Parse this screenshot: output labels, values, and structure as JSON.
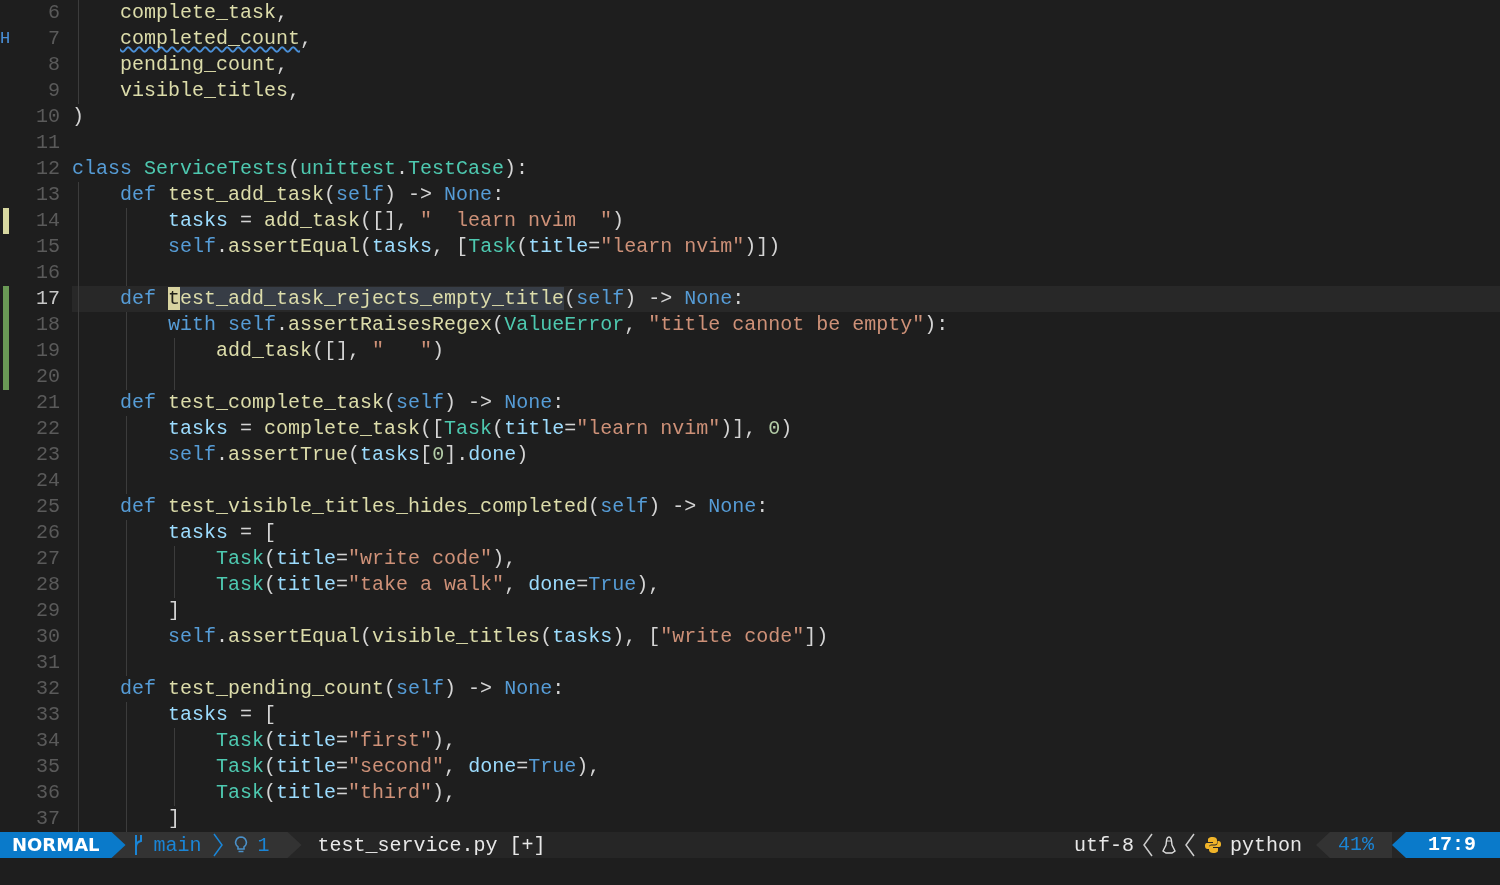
{
  "editor": {
    "lines": [
      {
        "number": "6",
        "modified": false,
        "added": false,
        "current": false,
        "tokens": [
          {
            "text": "    complete_task",
            "kind": "function"
          },
          {
            "text": ",",
            "kind": "plain"
          }
        ]
      },
      {
        "number": "7",
        "sign": "H",
        "modified": false,
        "added": false,
        "current": false,
        "tokens": [
          {
            "text": "    completed_count",
            "kind": "function",
            "diagnostic": true
          },
          {
            "text": ",",
            "kind": "plain",
            "diagnostic": false
          }
        ]
      },
      {
        "number": "8",
        "modified": false,
        "added": false,
        "current": false,
        "tokens": [
          {
            "text": "    pending_count",
            "kind": "function"
          },
          {
            "text": ",",
            "kind": "plain"
          }
        ]
      },
      {
        "number": "9",
        "modified": false,
        "added": false,
        "current": false,
        "tokens": [
          {
            "text": "    visible_titles",
            "kind": "function"
          },
          {
            "text": ",",
            "kind": "plain"
          }
        ]
      },
      {
        "number": "10",
        "modified": false,
        "added": false,
        "current": false,
        "tokens": [
          {
            "text": ")",
            "kind": "plain"
          }
        ]
      },
      {
        "number": "11",
        "modified": false,
        "added": false,
        "current": false
      },
      {
        "number": "12",
        "modified": false,
        "added": false,
        "current": false,
        "tokens": [
          {
            "text": "class ",
            "kind": "keyword"
          },
          {
            "text": "ServiceTests",
            "kind": "type"
          },
          {
            "text": "(",
            "kind": "plain"
          },
          {
            "text": "unittest",
            "kind": "type"
          },
          {
            "text": ".",
            "kind": "plain"
          },
          {
            "text": "TestCase",
            "kind": "type"
          },
          {
            "text": "):",
            "kind": "plain"
          }
        ]
      },
      {
        "number": "13",
        "modified": false,
        "added": false,
        "current": false,
        "tokens": [
          {
            "text": "    def ",
            "kind": "keyword"
          },
          {
            "text": "test_add_task",
            "kind": "function"
          },
          {
            "text": "(",
            "kind": "plain"
          },
          {
            "text": "self",
            "kind": "keyword"
          },
          {
            "text": ") -> ",
            "kind": "plain"
          },
          {
            "text": "None",
            "kind": "keyword"
          },
          {
            "text": ":",
            "kind": "plain"
          }
        ]
      },
      {
        "number": "14",
        "modified": true,
        "added": false,
        "current": false,
        "tokens": [
          {
            "text": "        tasks",
            "kind": "variable"
          },
          {
            "text": " = ",
            "kind": "plain"
          },
          {
            "text": "add_task",
            "kind": "function"
          },
          {
            "text": "([], ",
            "kind": "plain"
          },
          {
            "text": "\"  learn nvim  \"",
            "kind": "string"
          },
          {
            "text": ")",
            "kind": "plain"
          }
        ]
      },
      {
        "number": "15",
        "modified": false,
        "added": false,
        "current": false,
        "tokens": [
          {
            "text": "        self",
            "kind": "keyword"
          },
          {
            "text": ".",
            "kind": "plain"
          },
          {
            "text": "assertEqual",
            "kind": "function"
          },
          {
            "text": "(",
            "kind": "plain"
          },
          {
            "text": "tasks",
            "kind": "variable"
          },
          {
            "text": ", [",
            "kind": "plain"
          },
          {
            "text": "Task",
            "kind": "type"
          },
          {
            "text": "(",
            "kind": "plain"
          },
          {
            "text": "title",
            "kind": "variable"
          },
          {
            "text": "=",
            "kind": "plain"
          },
          {
            "text": "\"learn nvim\"",
            "kind": "string"
          },
          {
            "text": ")])",
            "kind": "plain"
          }
        ]
      },
      {
        "number": "16",
        "modified": false,
        "added": false,
        "current": false
      },
      {
        "number": "17",
        "modified": false,
        "added": true,
        "current": true,
        "tokens": [
          {
            "text": "    def ",
            "kind": "keyword",
            "cursor": false,
            "highlighted": false
          },
          {
            "text": "t",
            "kind": "function",
            "cursor": true,
            "highlighted": true
          },
          {
            "text": "est_add_task_rejects_empty_title",
            "kind": "function",
            "cursor": false,
            "highlighted": true
          },
          {
            "text": "(",
            "kind": "plain",
            "cursor": false,
            "highlighted": false
          },
          {
            "text": "self",
            "kind": "keyword",
            "cursor": false,
            "highlighted": false
          },
          {
            "text": ") -> ",
            "kind": "plain",
            "cursor": false,
            "highlighted": false
          },
          {
            "text": "None",
            "kind": "keyword",
            "cursor": false,
            "highlighted": false
          },
          {
            "text": ":",
            "kind": "plain",
            "cursor": false,
            "highlighted": false
          }
        ]
      },
      {
        "number": "18",
        "modified": false,
        "added": true,
        "current": false,
        "tokens": [
          {
            "text": "        with ",
            "kind": "keyword"
          },
          {
            "text": "self",
            "kind": "keyword"
          },
          {
            "text": ".",
            "kind": "plain"
          },
          {
            "text": "assertRaisesRegex",
            "kind": "function"
          },
          {
            "text": "(",
            "kind": "plain"
          },
          {
            "text": "ValueError",
            "kind": "type"
          },
          {
            "text": ", ",
            "kind": "plain"
          },
          {
            "text": "\"title cannot be empty\"",
            "kind": "string"
          },
          {
            "text": "):",
            "kind": "plain"
          }
        ]
      },
      {
        "number": "19",
        "modified": false,
        "added": true,
        "current": false,
        "tokens": [
          {
            "text": "            add_task",
            "kind": "function"
          },
          {
            "text": "([], ",
            "kind": "plain"
          },
          {
            "text": "\"   \"",
            "kind": "string"
          },
          {
            "text": ")",
            "kind": "plain"
          }
        ]
      },
      {
        "number": "20",
        "modified": false,
        "added": true,
        "current": false
      },
      {
        "number": "21",
        "modified": false,
        "added": false,
        "current": false,
        "tokens": [
          {
            "text": "    def ",
            "kind": "keyword"
          },
          {
            "text": "test_complete_task",
            "kind": "function"
          },
          {
            "text": "(",
            "kind": "plain"
          },
          {
            "text": "self",
            "kind": "keyword"
          },
          {
            "text": ") -> ",
            "kind": "plain"
          },
          {
            "text": "None",
            "kind": "keyword"
          },
          {
            "text": ":",
            "kind": "plain"
          }
        ]
      },
      {
        "number": "22",
        "modified": false,
        "added": false,
        "current": false,
        "tokens": [
          {
            "text": "        tasks",
            "kind": "variable"
          },
          {
            "text": " = ",
            "kind": "plain"
          },
          {
            "text": "complete_task",
            "kind": "function"
          },
          {
            "text": "([",
            "kind": "plain"
          },
          {
            "text": "Task",
            "kind": "type"
          },
          {
            "text": "(",
            "kind": "plain"
          },
          {
            "text": "title",
            "kind": "variable"
          },
          {
            "text": "=",
            "kind": "plain"
          },
          {
            "text": "\"learn nvim\"",
            "kind": "string"
          },
          {
            "text": ")], ",
            "kind": "plain"
          },
          {
            "text": "0",
            "kind": "number"
          },
          {
            "text": ")",
            "kind": "plain"
          }
        ]
      },
      {
        "number": "23",
        "modified": false,
        "added": false,
        "current": false,
        "tokens": [
          {
            "text": "        self",
            "kind": "keyword"
          },
          {
            "text": ".",
            "kind": "plain"
          },
          {
            "text": "assertTrue",
            "kind": "function"
          },
          {
            "text": "(",
            "kind": "plain"
          },
          {
            "text": "tasks",
            "kind": "variable"
          },
          {
            "text": "[",
            "kind": "plain"
          },
          {
            "text": "0",
            "kind": "number"
          },
          {
            "text": "].",
            "kind": "plain"
          },
          {
            "text": "done",
            "kind": "variable"
          },
          {
            "text": ")",
            "kind": "plain"
          }
        ]
      },
      {
        "number": "24",
        "modified": false,
        "added": false,
        "current": false
      },
      {
        "number": "25",
        "modified": false,
        "added": false,
        "current": false,
        "tokens": [
          {
            "text": "    def ",
            "kind": "keyword"
          },
          {
            "text": "test_visible_titles_hides_completed",
            "kind": "function"
          },
          {
            "text": "(",
            "kind": "plain"
          },
          {
            "text": "self",
            "kind": "keyword"
          },
          {
            "text": ") -> ",
            "kind": "plain"
          },
          {
            "text": "None",
            "kind": "keyword"
          },
          {
            "text": ":",
            "kind": "plain"
          }
        ]
      },
      {
        "number": "26",
        "modified": false,
        "added": false,
        "current": false,
        "tokens": [
          {
            "text": "        tasks",
            "kind": "variable"
          },
          {
            "text": " = [",
            "kind": "plain"
          }
        ]
      },
      {
        "number": "27",
        "modified": false,
        "added": false,
        "current": false,
        "tokens": [
          {
            "text": "            Task",
            "kind": "type"
          },
          {
            "text": "(",
            "kind": "plain"
          },
          {
            "text": "title",
            "kind": "variable"
          },
          {
            "text": "=",
            "kind": "plain"
          },
          {
            "text": "\"write code\"",
            "kind": "string"
          },
          {
            "text": "),",
            "kind": "plain"
          }
        ]
      },
      {
        "number": "28",
        "modified": false,
        "added": false,
        "current": false,
        "tokens": [
          {
            "text": "            Task",
            "kind": "type"
          },
          {
            "text": "(",
            "kind": "plain"
          },
          {
            "text": "title",
            "kind": "variable"
          },
          {
            "text": "=",
            "kind": "plain"
          },
          {
            "text": "\"take a walk\"",
            "kind": "string"
          },
          {
            "text": ", ",
            "kind": "plain"
          },
          {
            "text": "done",
            "kind": "variable"
          },
          {
            "text": "=",
            "kind": "plain"
          },
          {
            "text": "True",
            "kind": "keyword"
          },
          {
            "text": "),",
            "kind": "plain"
          }
        ]
      },
      {
        "number": "29",
        "modified": false,
        "added": false,
        "current": false,
        "tokens": [
          {
            "text": "        ]",
            "kind": "plain"
          }
        ]
      },
      {
        "number": "30",
        "modified": false,
        "added": false,
        "current": false,
        "tokens": [
          {
            "text": "        self",
            "kind": "keyword"
          },
          {
            "text": ".",
            "kind": "plain"
          },
          {
            "text": "assertEqual",
            "kind": "function"
          },
          {
            "text": "(",
            "kind": "plain"
          },
          {
            "text": "visible_titles",
            "kind": "function"
          },
          {
            "text": "(",
            "kind": "plain"
          },
          {
            "text": "tasks",
            "kind": "variable"
          },
          {
            "text": "), [",
            "kind": "plain"
          },
          {
            "text": "\"write code\"",
            "kind": "string"
          },
          {
            "text": "])",
            "kind": "plain"
          }
        ]
      },
      {
        "number": "31",
        "modified": false,
        "added": false,
        "current": false
      },
      {
        "number": "32",
        "modified": false,
        "added": false,
        "current": false,
        "tokens": [
          {
            "text": "    def ",
            "kind": "keyword"
          },
          {
            "text": "test_pending_count",
            "kind": "function"
          },
          {
            "text": "(",
            "kind": "plain"
          },
          {
            "text": "self",
            "kind": "keyword"
          },
          {
            "text": ") -> ",
            "kind": "plain"
          },
          {
            "text": "None",
            "kind": "keyword"
          },
          {
            "text": ":",
            "kind": "plain"
          }
        ]
      },
      {
        "number": "33",
        "modified": false,
        "added": false,
        "current": false,
        "tokens": [
          {
            "text": "        tasks",
            "kind": "variable"
          },
          {
            "text": " = [",
            "kind": "plain"
          }
        ]
      },
      {
        "number": "34",
        "modified": false,
        "added": false,
        "current": false,
        "tokens": [
          {
            "text": "            Task",
            "kind": "type"
          },
          {
            "text": "(",
            "kind": "plain"
          },
          {
            "text": "title",
            "kind": "variable"
          },
          {
            "text": "=",
            "kind": "plain"
          },
          {
            "text": "\"first\"",
            "kind": "string"
          },
          {
            "text": "),",
            "kind": "plain"
          }
        ]
      },
      {
        "number": "35",
        "modified": false,
        "added": false,
        "current": false,
        "tokens": [
          {
            "text": "            Task",
            "kind": "type"
          },
          {
            "text": "(",
            "kind": "plain"
          },
          {
            "text": "title",
            "kind": "variable"
          },
          {
            "text": "=",
            "kind": "plain"
          },
          {
            "text": "\"second\"",
            "kind": "string"
          },
          {
            "text": ", ",
            "kind": "plain"
          },
          {
            "text": "done",
            "kind": "variable"
          },
          {
            "text": "=",
            "kind": "plain"
          },
          {
            "text": "True",
            "kind": "keyword"
          },
          {
            "text": "),",
            "kind": "plain"
          }
        ]
      },
      {
        "number": "36",
        "modified": false,
        "added": false,
        "current": false,
        "tokens": [
          {
            "text": "            Task",
            "kind": "type"
          },
          {
            "text": "(",
            "kind": "plain"
          },
          {
            "text": "title",
            "kind": "variable"
          },
          {
            "text": "=",
            "kind": "plain"
          },
          {
            "text": "\"third\"",
            "kind": "string"
          },
          {
            "text": "),",
            "kind": "plain"
          }
        ]
      },
      {
        "number": "37",
        "modified": false,
        "added": false,
        "current": false,
        "tokens": [
          {
            "text": "        ]",
            "kind": "plain"
          }
        ]
      }
    ]
  },
  "status_bar": {
    "mode": "NORMAL",
    "branch": "main",
    "diagnostics": "1",
    "file": "test_service.py [+]",
    "encoding": "utf-8",
    "filetype": "python",
    "progress": "41%",
    "position": "17:9"
  }
}
